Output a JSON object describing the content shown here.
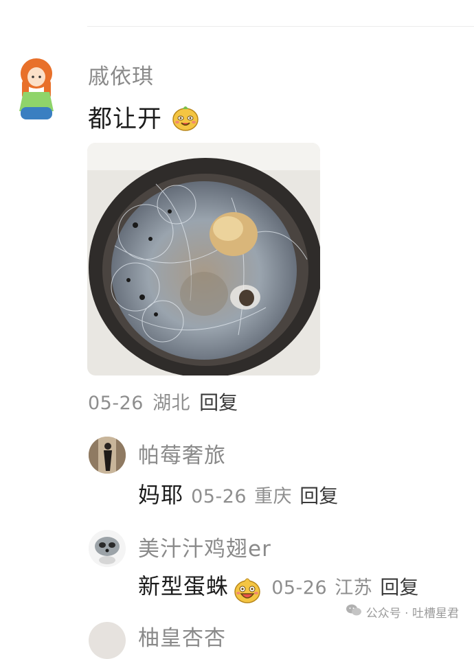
{
  "comment": {
    "username": "戚依琪",
    "text": "都让开",
    "date": "05-26",
    "location": "湖北",
    "reply_label": "回复"
  },
  "replies": [
    {
      "username": "帕莓奢旅",
      "text": "妈耶",
      "date": "05-26",
      "location": "重庆",
      "reply_label": "回复"
    },
    {
      "username": "美汁汁鸡翅er",
      "text": "新型蛋蛛",
      "date": "05-26",
      "location": "江苏",
      "reply_label": "回复"
    },
    {
      "username": "柚皇杏杏"
    }
  ],
  "watermark": {
    "text": "公众号 · 吐槽星君",
    "icon": "wechat-icon"
  },
  "colors": {
    "username": "#8a8a8a",
    "text": "#1c1c1c",
    "meta": "#8e8e8e"
  }
}
